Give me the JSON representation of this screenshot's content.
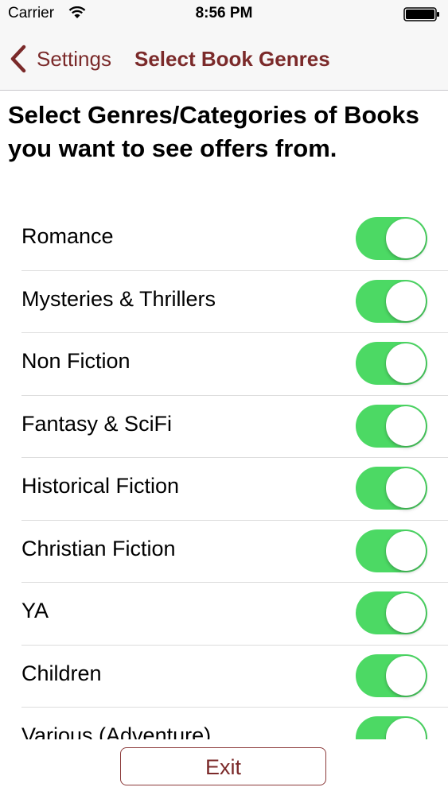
{
  "status_bar": {
    "carrier": "Carrier",
    "time": "8:56 PM",
    "wifi_icon": "wifi-icon",
    "battery_icon": "battery-icon"
  },
  "nav": {
    "back_label": "Settings",
    "title": "Select Book Genres",
    "accent_color": "#7b2a2a"
  },
  "heading": "Select Genres/Categories of Books you want to see offers from.",
  "genres": [
    {
      "label": "Romance",
      "enabled": true
    },
    {
      "label": "Mysteries & Thrillers",
      "enabled": true
    },
    {
      "label": "Non Fiction",
      "enabled": true
    },
    {
      "label": "Fantasy & SciFi",
      "enabled": true
    },
    {
      "label": "Historical Fiction",
      "enabled": true
    },
    {
      "label": "Christian Fiction",
      "enabled": true
    },
    {
      "label": "YA",
      "enabled": true
    },
    {
      "label": "Children",
      "enabled": true
    },
    {
      "label": "Various (Adventure)",
      "enabled": true
    }
  ],
  "toggle_on_color": "#4cd964",
  "exit_label": "Exit"
}
